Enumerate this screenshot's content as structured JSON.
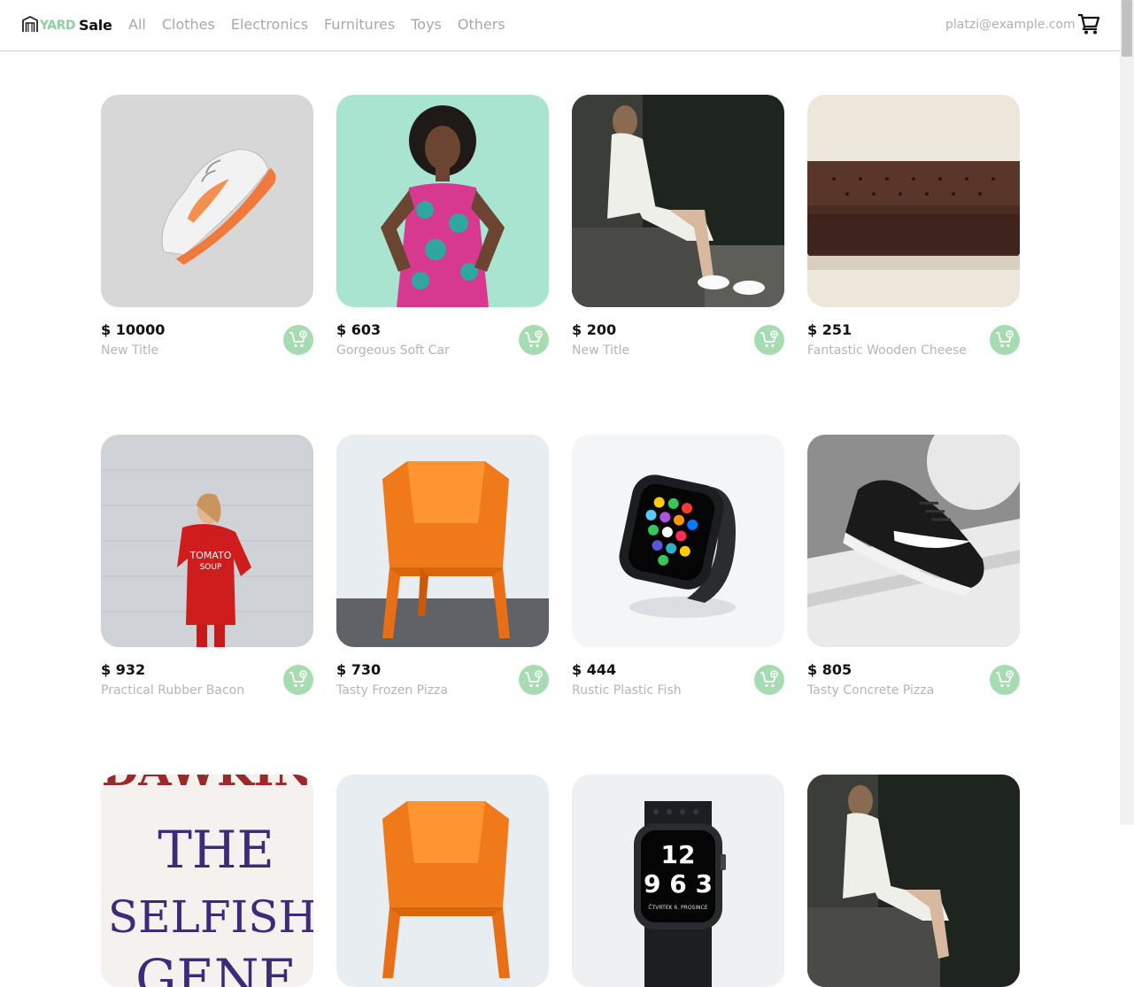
{
  "brand": {
    "part1": "YARD",
    "part2": "Sale"
  },
  "nav": {
    "categories": [
      "All",
      "Clothes",
      "Electronics",
      "Furnitures",
      "Toys",
      "Others"
    ]
  },
  "user": {
    "email": "platzi@example.com"
  },
  "icons": {
    "cart": "shopping-cart-icon",
    "add_to_cart": "add-to-cart-icon",
    "logo": "storefront-icon"
  },
  "colors": {
    "accent": "#8fd19e",
    "button": "#a7dbb1"
  },
  "products": [
    {
      "price": "$ 10000",
      "title": "New Title",
      "image": "sneaker"
    },
    {
      "price": "$ 603",
      "title": "Gorgeous Soft Car",
      "image": "woman-dress"
    },
    {
      "price": "$ 200",
      "title": "New Title",
      "image": "woman-rocks"
    },
    {
      "price": "$ 251",
      "title": "Fantastic Wooden Cheese",
      "image": "leather-sofa"
    },
    {
      "price": "$ 932",
      "title": "Practical Rubber Bacon",
      "image": "red-sweater"
    },
    {
      "price": "$ 730",
      "title": "Tasty Frozen Pizza",
      "image": "orange-chair"
    },
    {
      "price": "$ 444",
      "title": "Rustic Plastic Fish",
      "image": "smartwatch"
    },
    {
      "price": "$ 805",
      "title": "Tasty Concrete Pizza",
      "image": "black-sneaker"
    },
    {
      "price": "",
      "title": "",
      "image": "book-cover",
      "cover_lines": [
        "DAWKIN",
        "THE",
        "SELFISH",
        "GENE"
      ]
    },
    {
      "price": "",
      "title": "",
      "image": "orange-chair"
    },
    {
      "price": "",
      "title": "",
      "image": "nike-watch",
      "watch_lines": [
        "12",
        "9 6 3",
        "ČTVRTEK 6. PROSINCE"
      ]
    },
    {
      "price": "",
      "title": "",
      "image": "woman-rocks"
    }
  ]
}
